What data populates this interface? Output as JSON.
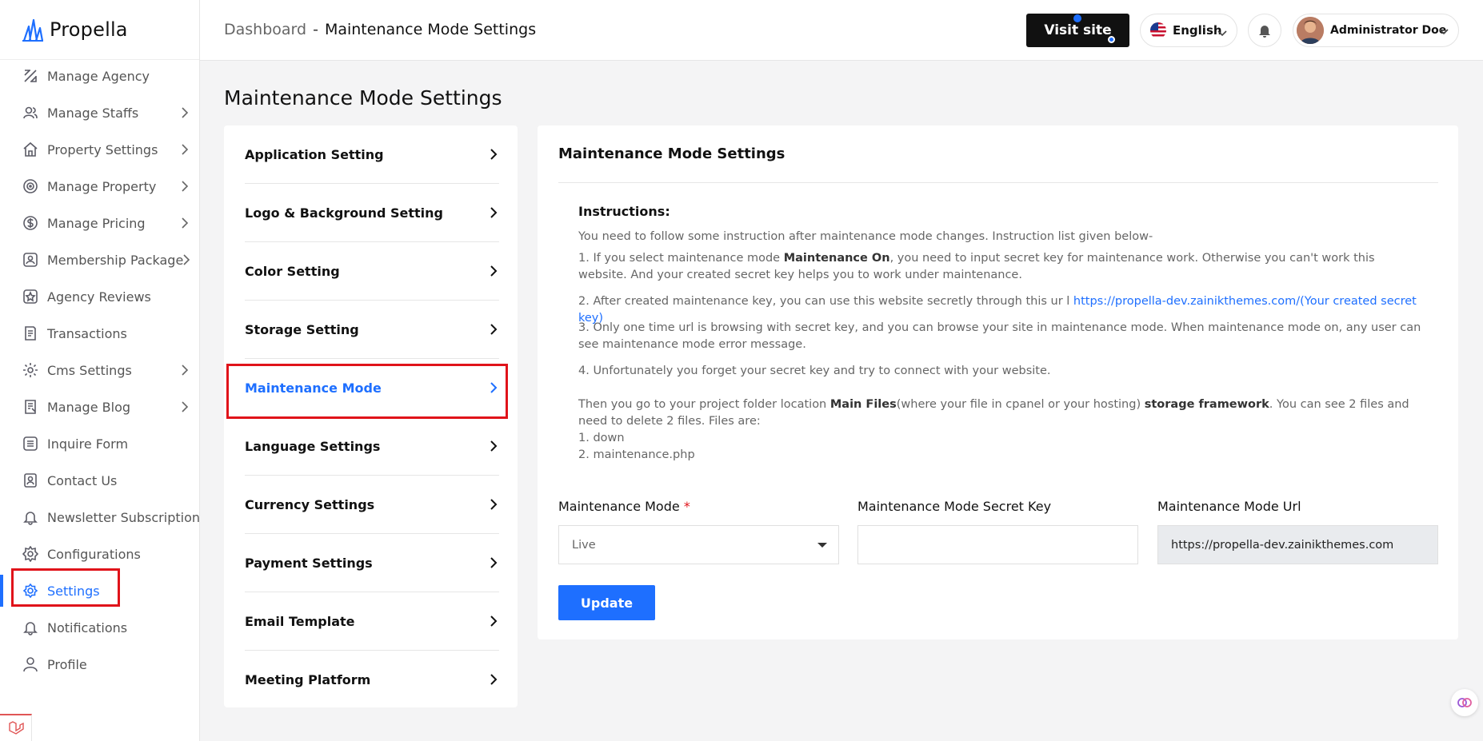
{
  "app": {
    "name": "Propella"
  },
  "sidebar": {
    "items": [
      {
        "label": "Manage Agency",
        "icon": "agency-icon",
        "chevron": false
      },
      {
        "label": "Manage Staffs",
        "icon": "users-icon",
        "chevron": true
      },
      {
        "label": "Property Settings",
        "icon": "house-icon",
        "chevron": true
      },
      {
        "label": "Manage Property",
        "icon": "property-icon",
        "chevron": true
      },
      {
        "label": "Manage Pricing",
        "icon": "dollar-icon",
        "chevron": true
      },
      {
        "label": "Membership Package",
        "icon": "member-icon",
        "chevron": true
      },
      {
        "label": "Agency Reviews",
        "icon": "star-icon",
        "chevron": false
      },
      {
        "label": "Transactions",
        "icon": "receipt-icon",
        "chevron": false
      },
      {
        "label": "Cms Settings",
        "icon": "gear-icon",
        "chevron": true
      },
      {
        "label": "Manage Blog",
        "icon": "blog-icon",
        "chevron": true
      },
      {
        "label": "Inquire Form",
        "icon": "list-icon",
        "chevron": false
      },
      {
        "label": "Contact Us",
        "icon": "contact-icon",
        "chevron": false
      },
      {
        "label": "Newsletter Subscription",
        "icon": "bell-icon",
        "chevron": false
      },
      {
        "label": "Configurations",
        "icon": "config-icon",
        "chevron": false
      },
      {
        "label": "Settings",
        "icon": "settings-icon",
        "chevron": false,
        "active": true
      },
      {
        "label": "Notifications",
        "icon": "bell-icon",
        "chevron": false
      },
      {
        "label": "Profile",
        "icon": "user-icon",
        "chevron": false
      }
    ]
  },
  "header": {
    "breadcrumb_root": "Dashboard",
    "breadcrumb_sep": "-",
    "breadcrumb_current": "Maintenance Mode Settings",
    "visit_site": "Visit site",
    "language": "English",
    "user_name": "Administrator Doe"
  },
  "page": {
    "title": "Maintenance Mode Settings"
  },
  "settings_menu": [
    {
      "label": "Application Setting"
    },
    {
      "label": "Logo & Background Setting"
    },
    {
      "label": "Color Setting"
    },
    {
      "label": "Storage Setting"
    },
    {
      "label": "Maintenance Mode",
      "active": true
    },
    {
      "label": "Language Settings"
    },
    {
      "label": "Currency Settings"
    },
    {
      "label": "Payment Settings"
    },
    {
      "label": "Email Template"
    },
    {
      "label": "Meeting Platform"
    }
  ],
  "main": {
    "title": "Maintenance Mode Settings",
    "instructions_title": "Instructions:",
    "intro": "You need to follow some instruction after maintenance mode changes. Instruction list given below-",
    "step1_a": "1. If you select maintenance mode ",
    "step1_b": "Maintenance On",
    "step1_c": ", you need to input secret key for maintenance work. Otherwise you can't work this website. And your created secret key helps you to work under maintenance.",
    "step2_a": "2. After created maintenance key, you can use this website secretly through this ur l ",
    "step2_link": "https://propella-dev.zainikthemes.com/(Your created secret key)",
    "step3": "3. Only one time url is browsing with secret key, and you can browse your site in maintenance mode. When maintenance mode on, any user can see maintenance mode error message.",
    "step4": "4. Unfortunately you forget your secret key and try to connect with your website.",
    "then_a": "Then you go to your project folder location ",
    "then_b": "Main Files",
    "then_c": "(where your file in cpanel or your hosting) ",
    "then_d": "storage framework",
    "then_e": ". You can see 2 files and need to delete 2 files. Files are:",
    "file1": "1. down",
    "file2": "2. maintenance.php",
    "mode_label": "Maintenance Mode",
    "required_mark": "*",
    "mode_value": "Live",
    "secret_label": "Maintenance Mode Secret Key",
    "secret_value": "",
    "url_label": "Maintenance Mode Url",
    "url_value": "https://propella-dev.zainikthemes.com",
    "update_button": "Update"
  },
  "colors": {
    "accent": "#1e6fff",
    "highlight": "#e0131a",
    "dark": "#111111"
  }
}
